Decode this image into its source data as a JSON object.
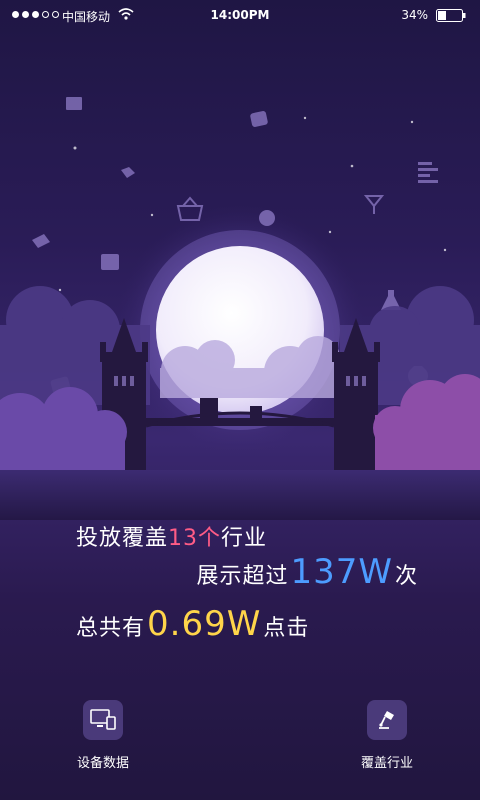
{
  "status_bar": {
    "carrier": "中国移动",
    "time": "14:00PM",
    "battery": "34%",
    "signal_bars_filled": 3,
    "signal_bars_total": 5,
    "battery_level": 0.34
  },
  "stats": {
    "line1_prefix": "投放覆盖",
    "line1_highlight": "13个",
    "line1_suffix": "行业",
    "line2_prefix": "展示超过",
    "line2_highlight": "137W",
    "line2_suffix": "次",
    "line3_prefix": "总共有",
    "line3_highlight": "0.69W",
    "line3_suffix": "点击"
  },
  "nav": {
    "devices_label": "设备数据",
    "industries_label": "覆盖行业"
  },
  "colors": {
    "accent_pink": "#ff5c86",
    "accent_blue": "#4d9cff",
    "accent_yellow": "#ffd54a",
    "background": "#2a1c57"
  }
}
